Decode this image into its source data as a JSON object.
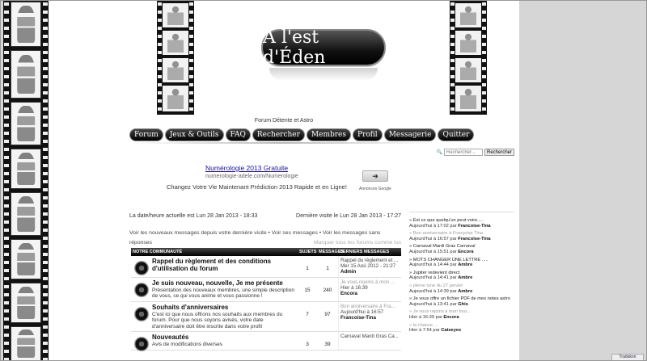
{
  "header": {
    "logo_text": "À l'est d'Éden",
    "site_description": "Forum Détente et Astro"
  },
  "nav": {
    "items": [
      {
        "label": "Forum"
      },
      {
        "label": "Jeux & Outils"
      },
      {
        "label": "FAQ"
      },
      {
        "label": "Rechercher"
      },
      {
        "label": "Membres"
      },
      {
        "label": "Profil"
      },
      {
        "label": "Messagerie"
      },
      {
        "label": "Quitter"
      }
    ]
  },
  "search": {
    "placeholder": "Rechercher...",
    "button_label": "Rechercher"
  },
  "ad": {
    "title": "Numérologie 2013 Gratuite",
    "url": "numerologie-adele.com/Numerologie",
    "text": "Changez Votre Vie Maintenant Prédiction 2013 Rapide et en Ligne!",
    "by": "Annonces Google",
    "arrow": "➔"
  },
  "info": {
    "current_date": "La date/heure actuelle est Lun 28 Jan 2013 - 18:33",
    "last_visit": "Dernière visite le Lun 28 Jan 2013 - 17:27",
    "links_line1": "Voir les nouveaux messages depuis votre dernière visite • Voir ses messages • Voir les messages sans",
    "links_line2": "réponses",
    "mark_read": "Marquer tous les forums comme lus"
  },
  "forum": {
    "headers": [
      "NOTRE COMMUNAUTÉ",
      "SUJETS",
      "MESSAGES",
      "DERNIERS MESSAGES"
    ],
    "rows": [
      {
        "title": "Rappel du règlement et des conditions d'utilisation du forum",
        "desc": "",
        "topics": "1",
        "posts": "1",
        "last_title": "Rappel du règlement et ...",
        "last_date": "Mer 15 Aoû 2012 - 21:27",
        "last_author": "Admin"
      },
      {
        "title": "Je suis nouveau, nouvelle, Je me présente",
        "desc": "Présentation des nouveaux membres, une simple description de vous, ce qui vous anime et vous passionne !",
        "topics": "15",
        "posts": "240",
        "last_title": "Je vous rejoins à mon ...",
        "last_date": "Hier à 16:39",
        "last_author": "Encora"
      },
      {
        "title": "Souhaits d'anniversaires",
        "desc": "C'est ici que nous offrons nos souhaits aux membres du forum. Pour que nous soyons avisés, votre date d'anniversaire doit être inscrite dans votre profil",
        "topics": "7",
        "posts": "97",
        "last_title": "Bon anniversaire à Fra...",
        "last_date": "Aujourd'hui à 16:57",
        "last_author": "Francoise-Tina"
      },
      {
        "title": "Nouveautés",
        "desc": "Avis de modifications diverses",
        "topics": "3",
        "posts": "39",
        "last_title": "Carnaval Mardi Gras Ca...",
        "last_date": "",
        "last_author": ""
      }
    ]
  },
  "sidebar": {
    "items": [
      {
        "title": "» Est ce que quelqu'un peut voire.....",
        "muted": false,
        "meta_prefix": "Aujourd'hui à 17:02 par",
        "author": "Francoise-Tina"
      },
      {
        "title": "» Bon anniversaire à Françoise Tina",
        "muted": true,
        "meta_prefix": "Aujourd'hui à 16:57 par",
        "author": "Francoise-Tina"
      },
      {
        "title": "» Carnaval Mardi Gras Carnaval",
        "muted": false,
        "meta_prefix": "Aujourd'hui à 15:51 par",
        "author": "Encora"
      },
      {
        "title": "» MOTS CHANGER UNE LETTRE .....",
        "muted": false,
        "meta_prefix": "Aujourd'hui à 14:44 par",
        "author": "Ambre"
      },
      {
        "title": "» Jupiter redevient direct",
        "muted": false,
        "meta_prefix": "Aujourd'hui à 14:41 par",
        "author": "Ambre"
      },
      {
        "title": "» pleine lune du 27 janvier",
        "muted": true,
        "meta_prefix": "Aujourd'hui à 14:39 par",
        "author": "Ambre"
      },
      {
        "title": "» Je vous offre un fichier PDF de mes notes astro",
        "muted": false,
        "meta_prefix": "Aujourd'hui à 13:41 par",
        "author": "Ghis"
      },
      {
        "title": "» Je vous rejoins à mon tour...",
        "muted": true,
        "meta_prefix": "Hier à 16:39 par",
        "author": "Encora"
      },
      {
        "title": "» la chance ...",
        "muted": true,
        "meta_prefix": "Hier à 7:54 par",
        "author": "Catseyes"
      }
    ]
  },
  "tradukon": "Tradukon"
}
